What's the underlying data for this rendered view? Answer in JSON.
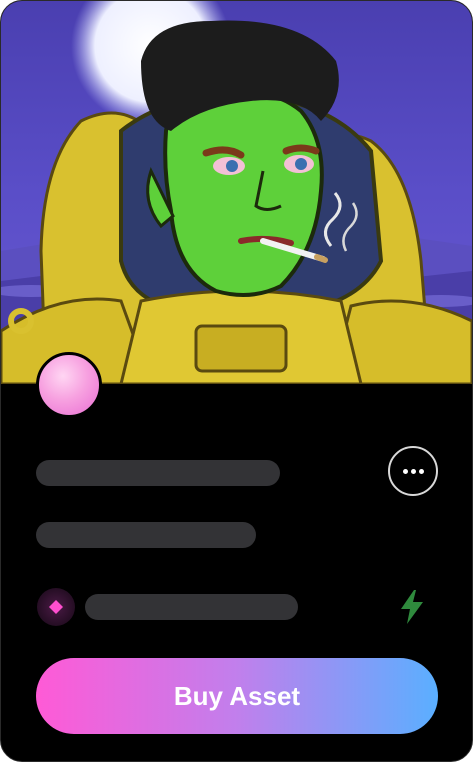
{
  "card": {
    "image_subject": "nft-artwork",
    "buy_label": "Buy Asset",
    "more_icon": "more-horizontal-icon",
    "currency_icon": "diamond-icon",
    "boost_icon": "lightning-bolt-icon"
  },
  "colors": {
    "card_bg": "#000000",
    "skeleton": "#333336",
    "button_gradient_start": "#ff5ad6",
    "button_gradient_end": "#5aafff",
    "gem_accent": "#ff4fcf",
    "bolt": "#2f8a3d"
  }
}
